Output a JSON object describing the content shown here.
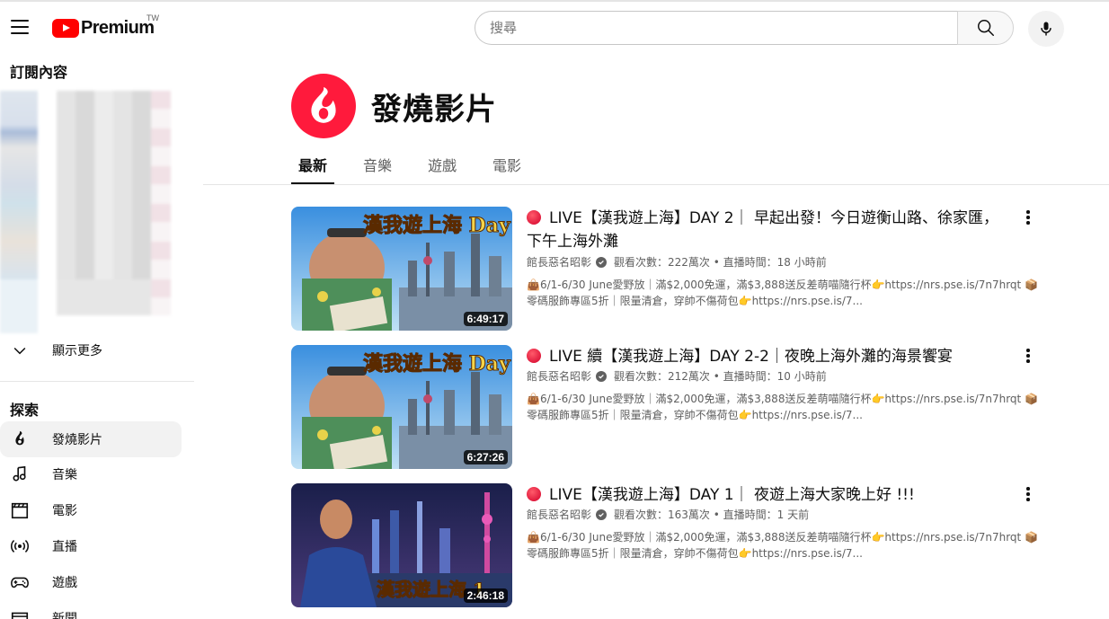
{
  "masthead": {
    "logo_text": "Premium",
    "region": "TW",
    "search_placeholder": "搜尋"
  },
  "sidebar": {
    "subscriptions_heading": "訂閱內容",
    "show_more": "顯示更多",
    "explore_heading": "探索",
    "explore_items": [
      {
        "label": "發燒影片",
        "icon": "trending-icon",
        "active": true
      },
      {
        "label": "音樂",
        "icon": "music-icon"
      },
      {
        "label": "電影",
        "icon": "movies-icon"
      },
      {
        "label": "直播",
        "icon": "live-icon"
      },
      {
        "label": "遊戲",
        "icon": "gaming-icon"
      },
      {
        "label": "新聞",
        "icon": "news-icon"
      }
    ]
  },
  "page": {
    "title": "發燒影片",
    "tabs": [
      {
        "label": "最新",
        "active": true
      },
      {
        "label": "音樂"
      },
      {
        "label": "遊戲"
      },
      {
        "label": "電影"
      }
    ]
  },
  "videos": [
    {
      "title": "LIVE【漢我遊上海】DAY 2｜ 早起出發！今日遊衡山路、徐家匯，下午上海外灘",
      "channel": "館長惡名昭彰",
      "views": "觀看次數：222萬次",
      "time": "直播時間：18 小時前",
      "desc": "👜6/1-6/30 June愛野放｜滿$2,000免運，滿$3,888送反差萌喵隨行杯👉https://nrs.pse.is/7n7hrqt 📦零碼服飾專區5折｜限量清倉，穿帥不傷荷包👉https://nrs.pse.is/7...",
      "duration": "6:49:17",
      "thumb_text": "漢我遊上海 Day 2"
    },
    {
      "title": "LIVE 續【漢我遊上海】DAY 2-2｜夜晚上海外灘的海景饗宴",
      "channel": "館長惡名昭彰",
      "views": "觀看次數：212萬次",
      "time": "直播時間：10 小時前",
      "desc": "👜6/1-6/30 June愛野放｜滿$2,000免運，滿$3,888送反差萌喵隨行杯👉https://nrs.pse.is/7n7hrqt 📦零碼服飾專區5折｜限量清倉，穿帥不傷荷包👉https://nrs.pse.is/7...",
      "duration": "6:27:26",
      "thumb_text": "漢我遊上海 Day 2"
    },
    {
      "title": "LIVE【漢我遊上海】DAY 1｜ 夜遊上海大家晚上好 !!!",
      "channel": "館長惡名昭彰",
      "views": "觀看次數：163萬次",
      "time": "直播時間：1 天前",
      "desc": "👜6/1-6/30 June愛野放｜滿$2,000免運，滿$3,888送反差萌喵隨行杯👉https://nrs.pse.is/7n7hrqt 📦零碼服飾專區5折｜限量清倉，穿帥不傷荷包👉https://nrs.pse.is/7...",
      "duration": "2:46:18",
      "thumb_text": "漢我遊上海 1"
    }
  ],
  "colors": {
    "brand_red": "#ff0000",
    "trending_red": "#ff1a3c",
    "text_primary": "#0f0f0f",
    "text_secondary": "#606060"
  }
}
